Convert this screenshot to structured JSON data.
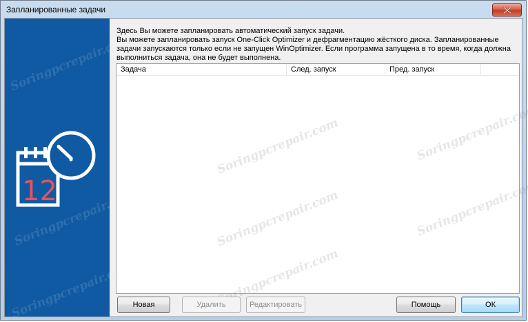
{
  "window": {
    "title": "Запланированные задачи"
  },
  "description": {
    "line1": "Здесь Вы можете запланировать автоматический запуск задачи.",
    "line2": "Вы можете запланировать запуск One-Click Optimizer и дефрагментацию жёсткого диска. Запланированные задачи запускаются только если не запущен WinOptimizer. Если программа запущена в то время, когда должна выполниться задача, она не будет выполнена."
  },
  "sidebar": {
    "icon_number": "12"
  },
  "task_list": {
    "columns": [
      "Задача",
      "След. запуск",
      "Пред. запуск"
    ],
    "rows": []
  },
  "buttons": {
    "new": "Новая",
    "delete": "Удалить",
    "edit": "Редактировать",
    "help": "Помощь",
    "ok": "ОК"
  },
  "watermark": "Soringpcrepair.com",
  "colors": {
    "sidebar": "#0f5aa3",
    "icon_accent": "#e8525a",
    "close_button": "#c9462c"
  }
}
